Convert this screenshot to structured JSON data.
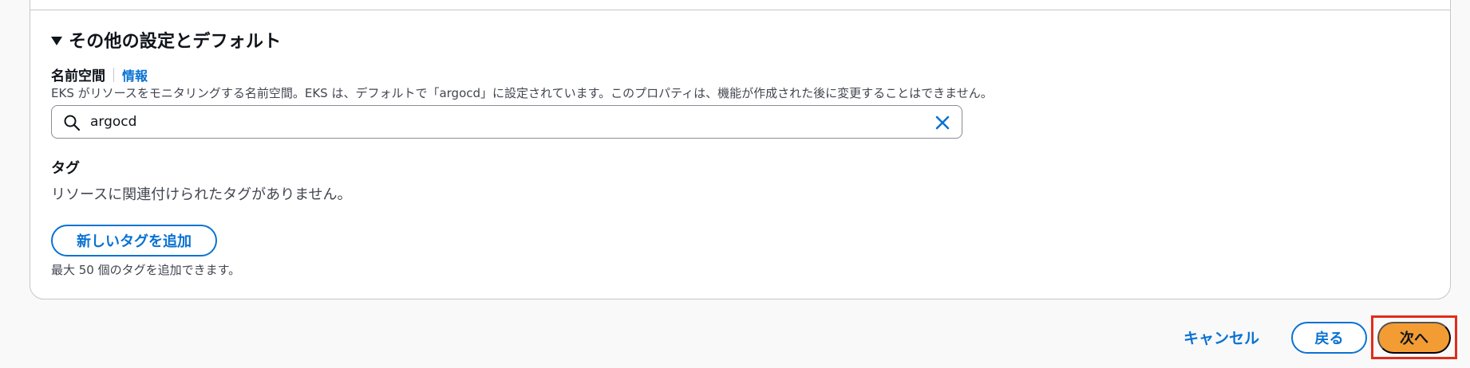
{
  "section": {
    "title": "その他の設定とデフォルト",
    "expanded": true
  },
  "namespace": {
    "label": "名前空間",
    "info_link": "情報",
    "description": "EKS がリソースをモニタリングする名前空間。EKS は、デフォルトで「argocd」に設定されています。このプロパティは、機能が作成された後に変更することはできません。",
    "value": "argocd",
    "icons": {
      "leading": "search-icon",
      "trailing": "close-icon"
    }
  },
  "tags": {
    "heading": "タグ",
    "empty_message": "リソースに関連付けられたタグがありません。",
    "add_button": "新しいタグを追加",
    "limit_note": "最大 50 個のタグを追加できます。"
  },
  "footer": {
    "cancel": "キャンセル",
    "back": "戻る",
    "next": "次へ"
  },
  "colors": {
    "link": "#0972d3",
    "primary_button": "#f39c33",
    "highlight_border": "#e02d1c"
  }
}
